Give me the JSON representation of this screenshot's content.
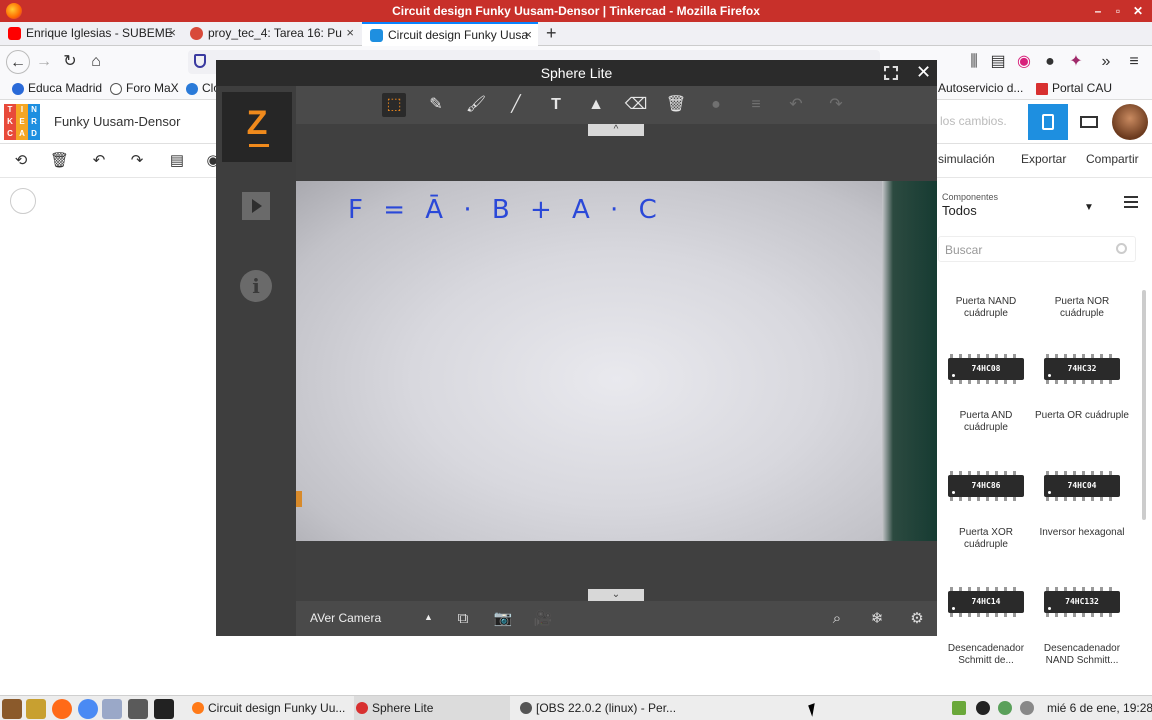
{
  "window": {
    "title": "Circuit design Funky Uusam-Densor | Tinkercad - Mozilla Firefox",
    "controls": [
      "–",
      "▫",
      "✕"
    ]
  },
  "tabs": [
    {
      "label": "Enrique Iglesias - SUBEME",
      "color": "#ff0000"
    },
    {
      "label": "proy_tec_4: Tarea 16: Pu",
      "color": "#d84a3a"
    },
    {
      "label": "Circuit design Funky Uusa",
      "color": "#1e8fe0"
    }
  ],
  "newtab_label": "+",
  "bookmarks": [
    {
      "label": "Educa Madrid",
      "color": "#2a6ad8"
    },
    {
      "label": "Foro MaX",
      "color": "#555555"
    },
    {
      "label": "Clo",
      "color": "#2a7ad8"
    },
    {
      "label": "Autoservicio d...",
      "color": "#3a6a3a"
    },
    {
      "label": "Portal CAU",
      "color": "#d83030"
    }
  ],
  "tinkercad": {
    "logo_letters": [
      "T",
      "I",
      "N",
      "K",
      "E",
      "R",
      "C",
      "A",
      "D"
    ],
    "logo_colors": [
      "#e84a3a",
      "#f5a623",
      "#1e8fe0",
      "#e84a3a",
      "#f5a623",
      "#1e8fe0",
      "#e84a3a",
      "#f5a623",
      "#1e8fe0"
    ],
    "design_title": "Funky Uusam-Densor",
    "save_status": "los cambios.",
    "actions": {
      "simulation": "simulación",
      "export": "Exportar",
      "share": "Compartir"
    },
    "components_label": "Componentes",
    "components_filter": "Todos",
    "search_placeholder": "Buscar",
    "components": [
      {
        "chip": "",
        "name": "Puerta NAND cuádruple"
      },
      {
        "chip": "",
        "name": "Puerta NOR cuádruple"
      },
      {
        "chip": "74HC08",
        "name": "Puerta AND cuádruple"
      },
      {
        "chip": "74HC32",
        "name": "Puerta OR cuádruple"
      },
      {
        "chip": "74HC86",
        "name": "Puerta XOR cuádruple"
      },
      {
        "chip": "74HC04",
        "name": "Inversor hexagonal"
      },
      {
        "chip": "74HC14",
        "name": "Desencadenador Schmitt de..."
      },
      {
        "chip": "74HC132",
        "name": "Desencadenador NAND Schmitt..."
      }
    ]
  },
  "sphere": {
    "title": "Sphere Lite",
    "logo": "Z",
    "info_icon_glyph": "i",
    "camera_source": "AVer Camera",
    "handwriting": "F = Ā · B + A · C",
    "collapse_up": "^",
    "collapse_down": "⌄"
  },
  "taskbar": {
    "tasks": [
      {
        "label": "Circuit design Funky Uu...",
        "color": "#ff7a18"
      },
      {
        "label": "Sphere Lite",
        "color": "#d83030"
      },
      {
        "label": "[OBS 22.0.2 (linux) - Per...",
        "color": "#555555"
      }
    ],
    "clock": "mié 6 de ene, 19:28"
  }
}
